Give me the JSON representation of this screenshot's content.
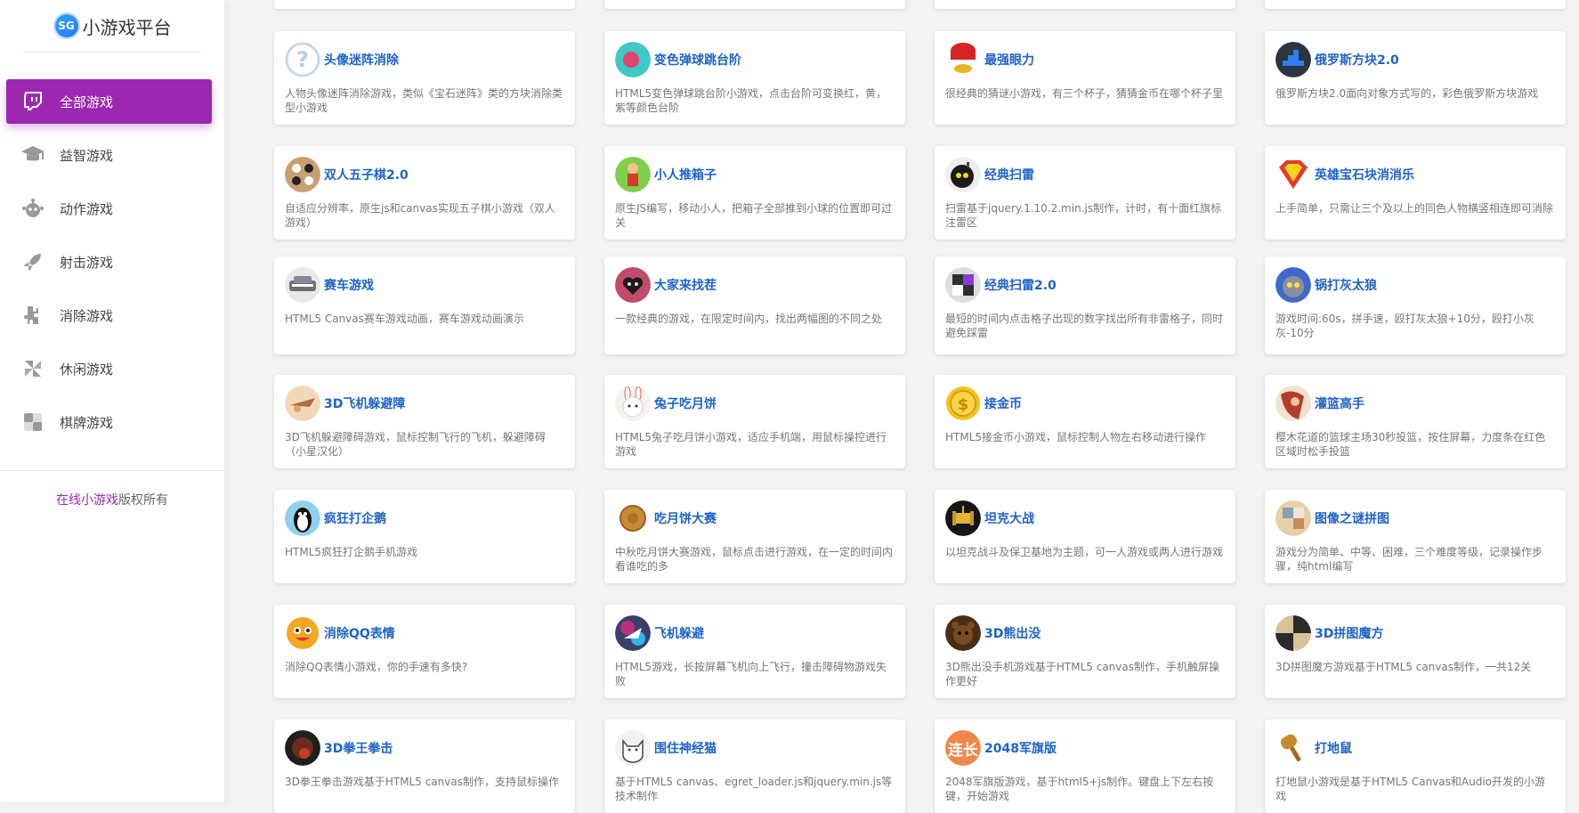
{
  "brand": {
    "logo_text": "SG",
    "title": "小游戏平台"
  },
  "menu": [
    {
      "label": "全部游戏",
      "icon": "twitch-icon",
      "active": true
    },
    {
      "label": "益智游戏",
      "icon": "graduation-cap-icon",
      "active": false
    },
    {
      "label": "动作游戏",
      "icon": "robot-icon",
      "active": false
    },
    {
      "label": "射击游戏",
      "icon": "rocket-icon",
      "active": false
    },
    {
      "label": "消除游戏",
      "icon": "puzzle-icon",
      "active": false
    },
    {
      "label": "休闲游戏",
      "icon": "pinwheel-icon",
      "active": false
    },
    {
      "label": "棋牌游戏",
      "icon": "chessboard-icon",
      "active": false
    }
  ],
  "footer": {
    "link_text": "在线小游戏",
    "suffix": "版权所有"
  },
  "games": [
    {
      "title": "头像迷阵消除",
      "desc": "人物头像迷阵消除游戏，类似《宝石迷阵》类的方块消除类型小游戏",
      "color": "#d8e6f3",
      "icon": "question-mark-icon"
    },
    {
      "title": "变色弹球跳台阶",
      "desc": "HTML5变色弹球跳台阶小游戏，点击台阶可变换红，黄，紫等颜色台阶",
      "color": "#3ec9c4",
      "icon": "ball-icon"
    },
    {
      "title": "最强眼力",
      "desc": "很经典的猜谜小游戏，有三个杯子，猜猜金币在哪个杯子里",
      "color": "#222222",
      "icon": "cup-icon"
    },
    {
      "title": "俄罗斯方块2.0",
      "desc": "俄罗斯方块2.0面向对象方式写的，彩色俄罗斯方块游戏",
      "color": "#2b3440",
      "icon": "tetris-icon"
    },
    {
      "title": "双人五子棋2.0",
      "desc": "自适应分辨率，原生js和canvas实现五子棋小游戏（双人游戏）",
      "color": "#c8a070",
      "icon": "gomoku-icon"
    },
    {
      "title": "小人推箱子",
      "desc": "原生JS编写，移动小人，把箱子全部推到小球的位置即可过关",
      "color": "#7fcf4a",
      "icon": "pusher-icon"
    },
    {
      "title": "经典扫雷",
      "desc": "扫雷基于jquery.1.10.2.min.js制作，计时，有十面红旗标注雷区",
      "color": "#1b1b1b",
      "icon": "mine-icon"
    },
    {
      "title": "英雄宝石块消消乐",
      "desc": "上手简单，只需让三个及以上的同色人物横竖相连即可消除",
      "color": "#e23a2e",
      "icon": "superman-icon"
    },
    {
      "title": "赛车游戏",
      "desc": "HTML5 Canvas赛车游戏动画，赛车游戏动画演示",
      "color": "#6a6f78",
      "icon": "car-icon"
    },
    {
      "title": "大家来找茬",
      "desc": "一款经典的游戏，在限定时间内，找出两幅图的不同之处",
      "color": "#c24a6a",
      "icon": "heart-icon"
    },
    {
      "title": "经典扫雷2.0",
      "desc": "最短的时间内点击格子出现的数字找出所有非雷格子，同时避免踩雷",
      "color": "#2f3033",
      "icon": "mine-grid-icon"
    },
    {
      "title": "锅打灰太狼",
      "desc": "游戏时间:60s，拼手速，殴打灰太狼+10分，殴打小灰灰-10分",
      "color": "#3d6bc7",
      "icon": "wolf-icon"
    },
    {
      "title": "3D飞机躲避障",
      "desc": "3D飞机躲避障碍游戏，鼠标控制飞行的飞机，躲避障碍（小星汉化）",
      "color": "#f1d9b7",
      "icon": "plane-icon"
    },
    {
      "title": "兔子吃月饼",
      "desc": "HTML5兔子吃月饼小游戏，适应手机端，用鼠标操控进行游戏",
      "color": "#f7f2ee",
      "icon": "rabbit-icon"
    },
    {
      "title": "接金币",
      "desc": "HTML5接金币小游戏，鼠标控制人物左右移动进行操作",
      "color": "#f4c21b",
      "icon": "coin-icon"
    },
    {
      "title": "灌篮高手",
      "desc": "樱木花道的篮球主场30秒投篮，按住屏幕，力度条在红色区域时松手投篮",
      "color": "#b53c2a",
      "icon": "basketball-icon"
    },
    {
      "title": "疯狂打企鹅",
      "desc": "HTML5疯狂打企鹅手机游戏",
      "color": "#8fd0ef",
      "icon": "penguin-icon"
    },
    {
      "title": "吃月饼大赛",
      "desc": "中秋吃月饼大赛游戏，鼠标点击进行游戏，在一定的时间内看谁吃的多",
      "color": "#c98a38",
      "icon": "mooncake-icon"
    },
    {
      "title": "坦克大战",
      "desc": "以坦克战斗及保卫基地为主题，可一人游戏或两人进行游戏",
      "color": "#151515",
      "icon": "tank-icon"
    },
    {
      "title": "图像之谜拼图",
      "desc": "游戏分为简单、中等、困难，三个难度等级，记录操作步骤，纯html编写",
      "color": "#e7cfa8",
      "icon": "jigsaw-icon"
    },
    {
      "title": "消除QQ表情",
      "desc": "消除QQ表情小游戏，你的手速有多快?",
      "color": "#f5a623",
      "icon": "emoji-icon"
    },
    {
      "title": "飞机躲避",
      "desc": "HTML5游戏，长按屏幕飞机向上飞行，撞击障碍物游戏失败",
      "color": "#3a3f6b",
      "icon": "aircraft-icon"
    },
    {
      "title": "3D熊出没",
      "desc": "3D熊出没手机游戏基于HTML5 canvas制作，手机触屏操作更好",
      "color": "#4a2d16",
      "icon": "bear-icon"
    },
    {
      "title": "3D拼图魔方",
      "desc": "3D拼图魔方游戏基于HTML5 canvas制作，一共12关",
      "color": "#2a2a2a",
      "icon": "cube-icon"
    },
    {
      "title": "3D拳王拳击",
      "desc": "3D拳王拳击游戏基于HTML5 canvas制作，支持鼠标操作",
      "color": "#6b2c1f",
      "icon": "boxer-icon"
    },
    {
      "title": "围住神经猫",
      "desc": "基于HTML5 canvas、egret_loader.js和jquery.min.js等技术制作",
      "color": "#f2f2f2",
      "icon": "cat-icon"
    },
    {
      "title": "2048军旗版",
      "desc": "2048军旗版游戏，基于html5+js制作。键盘上下左右按键，开始游戏",
      "color": "#f0874a",
      "icon": "lianzhang-icon",
      "avatar_text": "连长"
    },
    {
      "title": "打地鼠",
      "desc": "打地鼠小游戏是基于HTML5 Canvas和Audio开发的小游戏",
      "color": "#c88a2e",
      "icon": "hammer-icon"
    }
  ]
}
